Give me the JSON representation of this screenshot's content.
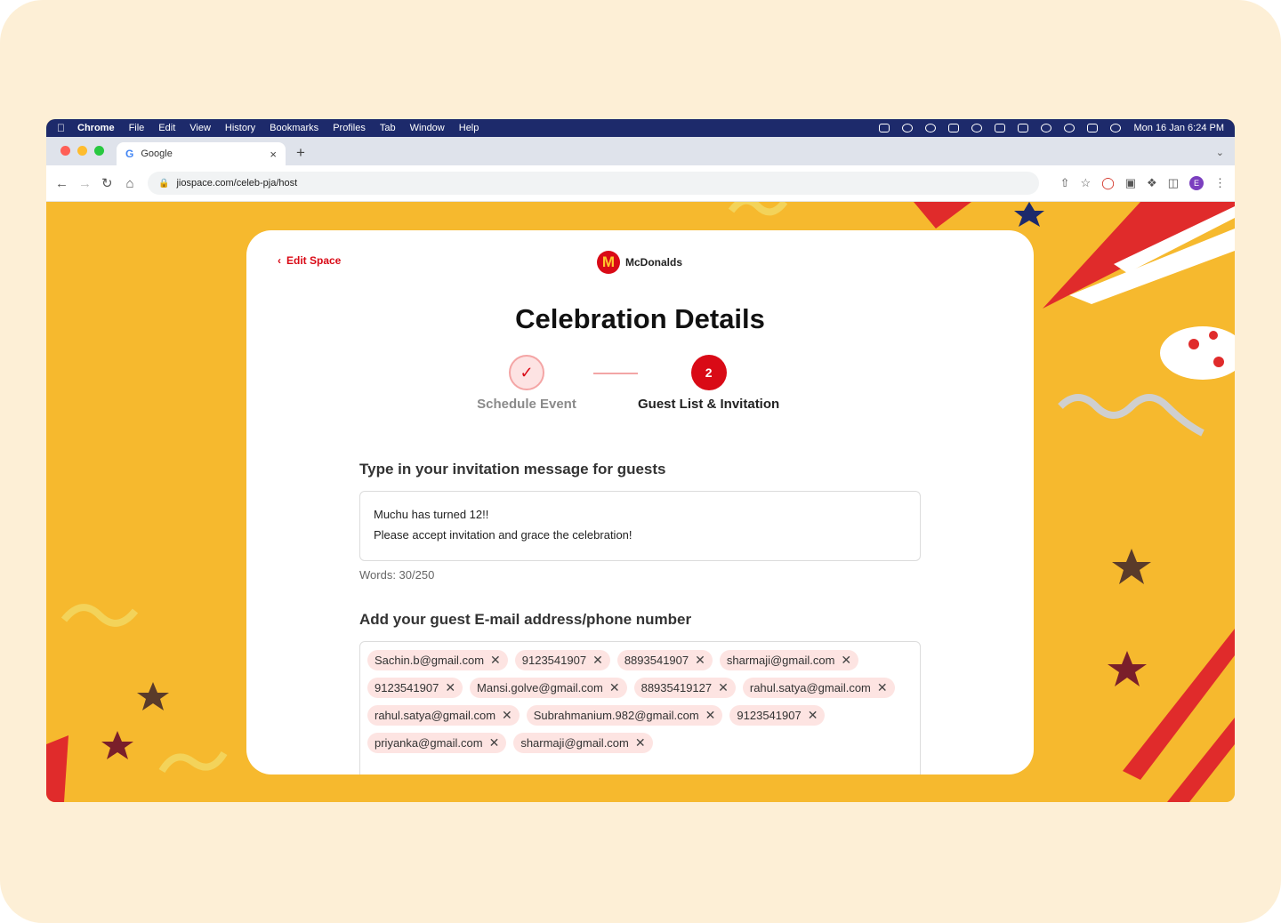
{
  "menubar": {
    "app": "Chrome",
    "items": [
      "File",
      "Edit",
      "View",
      "History",
      "Bookmarks",
      "Profiles",
      "Tab",
      "Window",
      "Help"
    ],
    "datetime": "Mon 16 Jan  6:24 PM"
  },
  "browser": {
    "tab_title": "Google",
    "new_tab": "+",
    "url": "jiospace.com/celeb-pja/host",
    "profile_initial": "E"
  },
  "page": {
    "back_label": "Edit Space",
    "brand_name": "McDonalds",
    "brand_logo_letter": "M",
    "title": "Celebration Details",
    "steps": [
      {
        "label": "Schedule Event",
        "state": "done"
      },
      {
        "number": "2",
        "label": "Guest List & Invitation",
        "state": "active"
      }
    ],
    "message_label": "Type in your invitation message for guests",
    "message_lines": [
      "Muchu has turned 12!!",
      "Please accept invitation and grace the celebration!"
    ],
    "word_count": "Words: 30/250",
    "guests_label": "Add your guest E-mail address/phone number",
    "guests": [
      "Sachin.b@gmail.com",
      "9123541907",
      "8893541907",
      "sharmaji@gmail.com",
      "9123541907",
      "Mansi.golve@gmail.com",
      "88935419127",
      "rahul.satya@gmail.com",
      "rahul.satya@gmail.com",
      "Subrahmanium.982@gmail.com",
      "9123541907",
      "priyanka@gmail.com",
      "sharmaji@gmail.com"
    ]
  },
  "colors": {
    "accent": "#d90a16",
    "background": "#f6b92e",
    "chip": "#fde4e2"
  }
}
